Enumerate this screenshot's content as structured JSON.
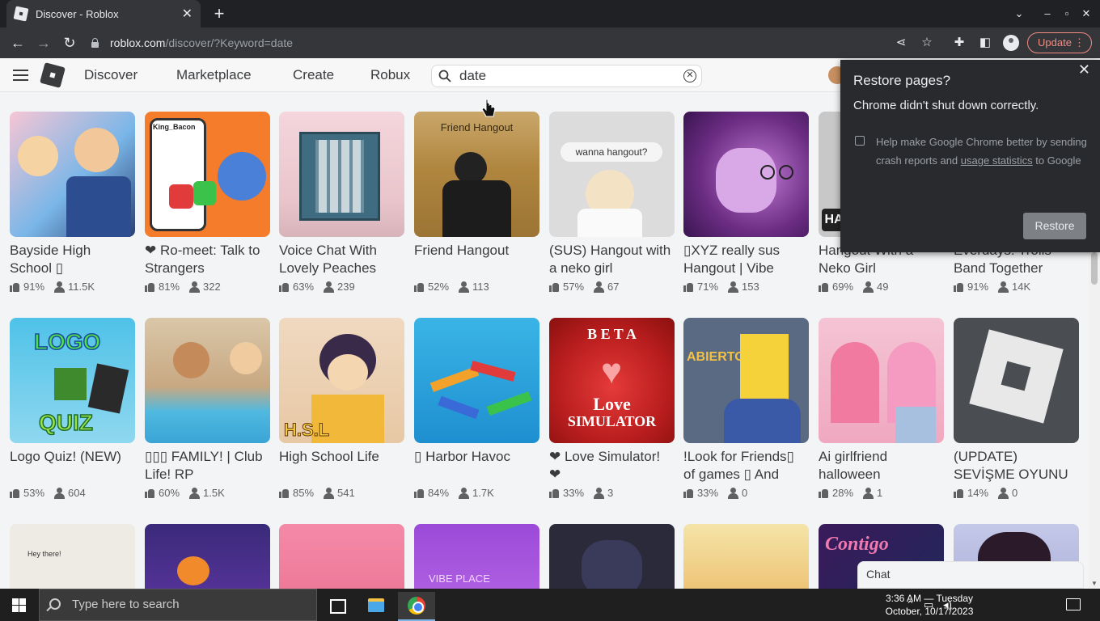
{
  "browser": {
    "tab_title": "Discover - Roblox",
    "url_host": "roblox.com",
    "url_path": "/discover/?Keyword=date",
    "update_label": "Update"
  },
  "nav": {
    "links": [
      "Discover",
      "Marketplace",
      "Create",
      "Robux"
    ],
    "search_value": "date"
  },
  "games": [
    {
      "title": "Bayside High School ▯",
      "rating": "91%",
      "players": "11.5K"
    },
    {
      "title": "❤ Ro-meet: Talk to Strangers",
      "rating": "81%",
      "players": "322"
    },
    {
      "title": "Voice Chat With Lovely Peaches",
      "rating": "63%",
      "players": "239"
    },
    {
      "title": "Friend Hangout",
      "rating": "52%",
      "players": "113"
    },
    {
      "title": "(SUS) Hangout with a neko girl",
      "rating": "57%",
      "players": "67"
    },
    {
      "title": "▯XYZ really sus Hangout | Vibe",
      "rating": "71%",
      "players": "153"
    },
    {
      "title": "Hangout With a Neko Girl",
      "rating": "69%",
      "players": "49"
    },
    {
      "title": "Everdays: Trolls Band Together",
      "rating": "91%",
      "players": "14K"
    },
    {
      "title": "Logo Quiz! (NEW)",
      "rating": "53%",
      "players": "604"
    },
    {
      "title": "▯▯▯ FAMILY! | Club Life! RP",
      "rating": "60%",
      "players": "1.5K"
    },
    {
      "title": "High School Life",
      "rating": "85%",
      "players": "541"
    },
    {
      "title": "▯ Harbor Havoc",
      "rating": "84%",
      "players": "1.7K"
    },
    {
      "title": "❤ Love Simulator! ❤",
      "rating": "33%",
      "players": "3"
    },
    {
      "title": "!Look for Friends▯ of games ▯ And",
      "rating": "33%",
      "players": "0"
    },
    {
      "title": "Ai girlfriend halloween",
      "rating": "28%",
      "players": "1"
    },
    {
      "title": "(UPDATE) SEVİŞME OYUNU",
      "rating": "14%",
      "players": "0"
    }
  ],
  "thumb_text": {
    "t2_tag": "King_Bacon",
    "t4": "Friend Hangout",
    "t5": "wanna hangout?",
    "t7": "HA",
    "t9a": "LOGO",
    "t9b": "QUIZ",
    "t11": "H.S.L",
    "t13a": "B E T A",
    "t13b": "Love",
    "t13c": "SIMULATOR",
    "t14": "ABIERTO!",
    "t17": "Hey there!",
    "t20": "VIBE   PLACE",
    "t23": "Contigo"
  },
  "chat_label": "Chat",
  "popup": {
    "title": "Restore pages?",
    "message": "Chrome didn't shut down correctly.",
    "help_prefix": "Help make Google Chrome better by sending crash reports and ",
    "help_link": "usage statistics",
    "help_suffix": " to Google",
    "restore_label": "Restore"
  },
  "taskbar": {
    "search_placeholder": "Type here to search",
    "time": "3:36 AM — Tuesday",
    "date": "October, 10/17/2023"
  },
  "colors": {
    "chrome_dark": "#202124",
    "roblox_text": "#393b3d",
    "update_accent": "#f28b82"
  }
}
